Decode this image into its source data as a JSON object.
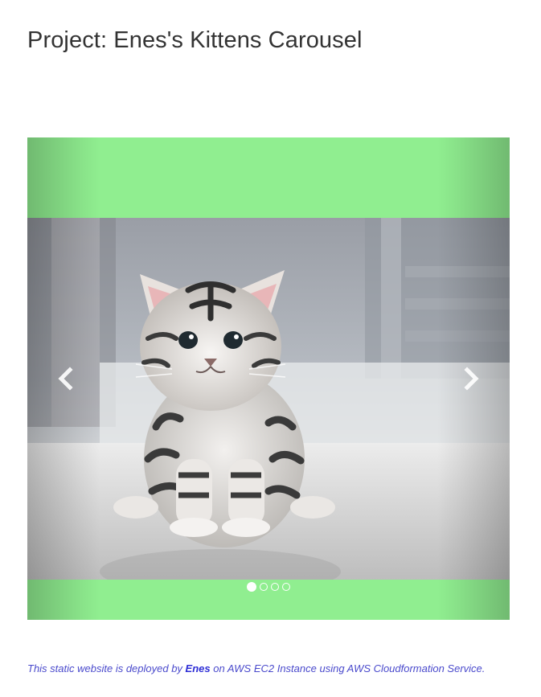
{
  "page": {
    "title": "Project: Enes's Kittens Carousel"
  },
  "carousel": {
    "background_color": "#90ee90",
    "slides": [
      {
        "image_icon": "kitten-photo",
        "active": true
      },
      {
        "image_icon": "kitten-photo",
        "active": false
      },
      {
        "image_icon": "kitten-photo",
        "active": false
      },
      {
        "image_icon": "kitten-photo",
        "active": false
      }
    ],
    "active_index": 0,
    "indicator_count": 4,
    "prev_icon": "chevron-left-icon",
    "next_icon": "chevron-right-icon"
  },
  "footer": {
    "text_before": "This static website is deployed by ",
    "author": "Enes",
    "text_after": " on AWS EC2 Instance using AWS Cloudformation Service.",
    "color": "#4a4acc"
  }
}
